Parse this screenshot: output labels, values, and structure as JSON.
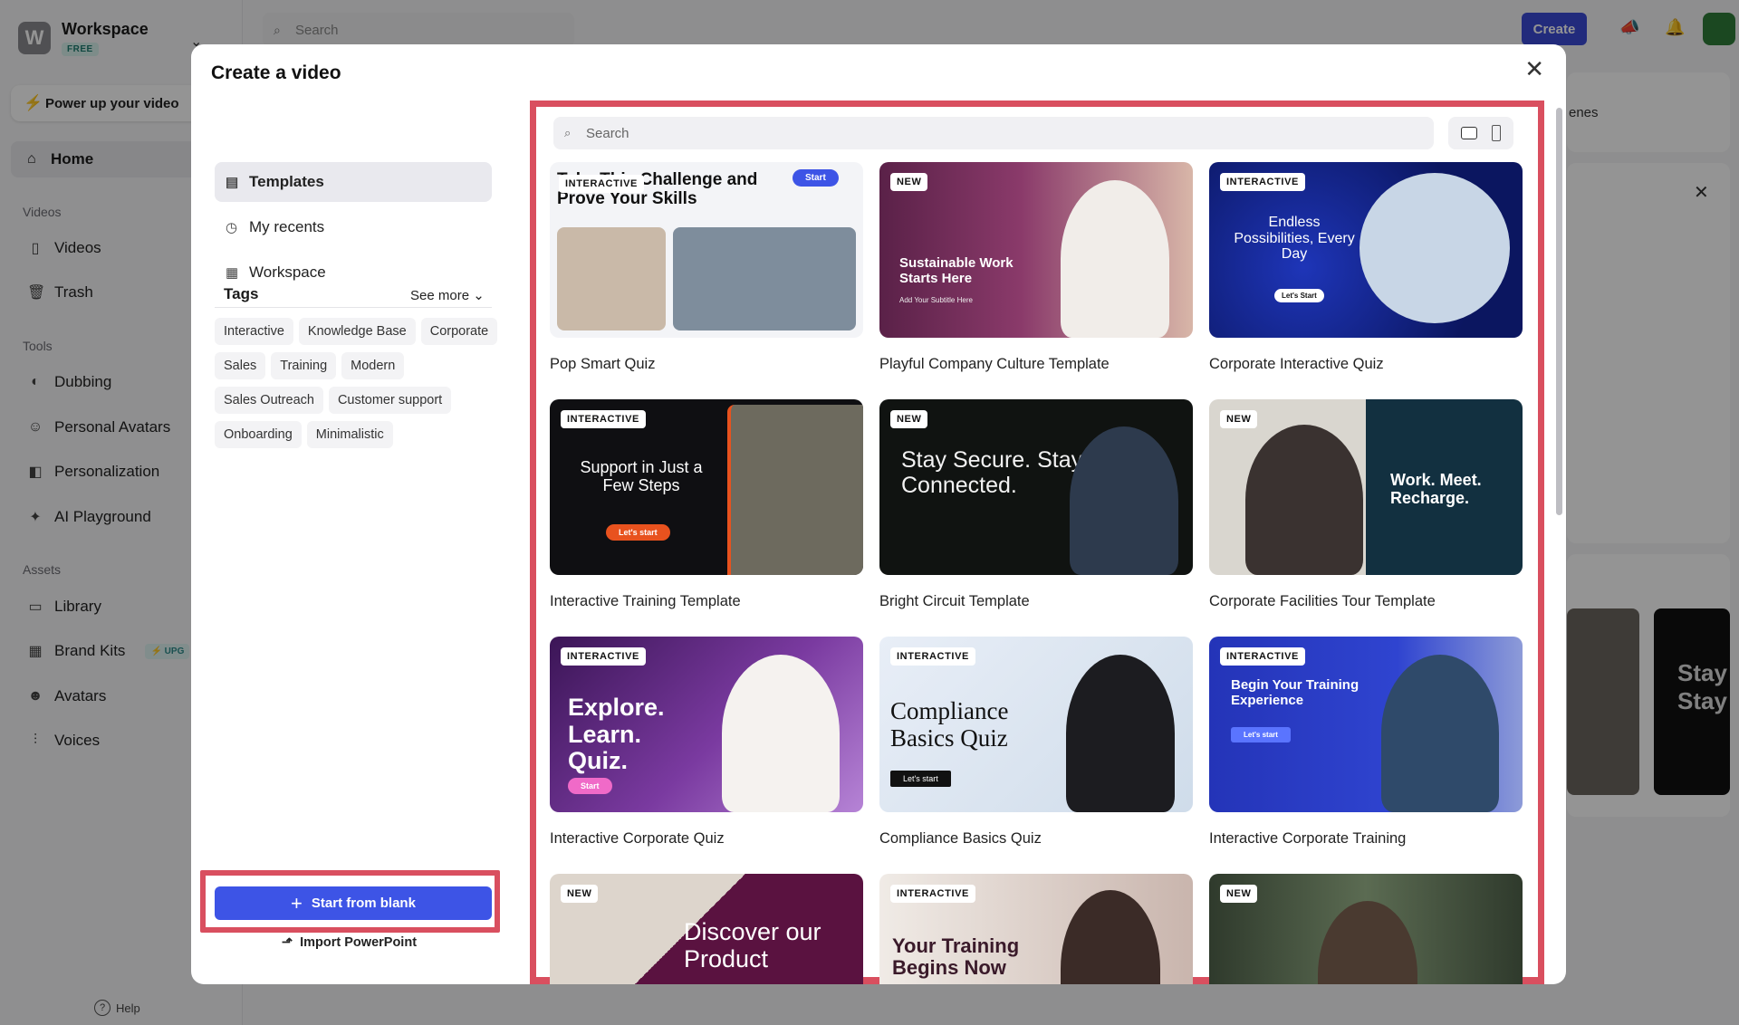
{
  "app": {
    "workspace_initial": "W",
    "workspace_name": "Workspace",
    "plan_badge": "FREE",
    "power_up": "Power up your video",
    "top_search_placeholder": "Search",
    "create_button": "Create",
    "help": "Help"
  },
  "sidebar": {
    "home": "Home",
    "sections": {
      "videos": "Videos",
      "tools": "Tools",
      "assets": "Assets"
    },
    "videos_items": [
      "Videos",
      "Trash"
    ],
    "tools_items": [
      "Dubbing",
      "Personal Avatars",
      "Personalization",
      "AI Playground"
    ],
    "assets_items": [
      "Library",
      "Brand Kits",
      "Avatars",
      "Voices"
    ],
    "upgrade_badge": "UPG"
  },
  "background": {
    "scenes_snippet": "enes",
    "preview_text": "Stay Stay"
  },
  "modal": {
    "title": "Create a video",
    "nav": [
      "Templates",
      "My recents",
      "Workspace"
    ],
    "tags_title": "Tags",
    "see_more": "See more",
    "tags": [
      "Interactive",
      "Knowledge Base",
      "Corporate",
      "Sales",
      "Training",
      "Modern",
      "Sales Outreach",
      "Customer support",
      "Onboarding",
      "Minimalistic"
    ],
    "start_blank": "Start from blank",
    "import_ppt": "Import PowerPoint",
    "search_placeholder": "Search",
    "templates": [
      {
        "name": "Pop Smart Quiz",
        "badge": "INTERACTIVE",
        "headline": "Take This Challenge and Prove Your Skills",
        "cta": "Start"
      },
      {
        "name": "Playful Company Culture Template",
        "badge": "NEW",
        "headline": "Sustainable Work Starts Here",
        "cta": "Add Your Subtitle Here"
      },
      {
        "name": "Corporate Interactive Quiz",
        "badge": "INTERACTIVE",
        "headline": "Endless Possibilities, Every Day",
        "cta": "Let's Start"
      },
      {
        "name": "Interactive Training Template",
        "badge": "INTERACTIVE",
        "headline": "Support in Just a Few Steps",
        "cta": "Let's start"
      },
      {
        "name": "Bright Circuit Template",
        "badge": "NEW",
        "headline": "Stay Secure. Stay Connected.",
        "cta": ""
      },
      {
        "name": "Corporate Facilities Tour Template",
        "badge": "NEW",
        "headline": "Work. Meet. Recharge.",
        "cta": ""
      },
      {
        "name": "Interactive Corporate Quiz",
        "badge": "INTERACTIVE",
        "headline": "Explore. Learn. Quiz.",
        "cta": "Start"
      },
      {
        "name": "Compliance Basics Quiz",
        "badge": "INTERACTIVE",
        "headline": "Compliance Basics Quiz",
        "cta": "Let's start"
      },
      {
        "name": "Interactive Corporate Training",
        "badge": "INTERACTIVE",
        "headline": "Begin Your Training Experience",
        "cta": "Let's start"
      },
      {
        "name": "",
        "badge": "NEW",
        "headline": "Discover our Product",
        "cta": ""
      },
      {
        "name": "",
        "badge": "INTERACTIVE",
        "headline": "Your Training Begins Now",
        "cta": ""
      },
      {
        "name": "",
        "badge": "NEW",
        "headline": "",
        "cta": ""
      }
    ]
  },
  "colors": {
    "highlight": "#d94f5f",
    "primary": "#3d54e6"
  }
}
